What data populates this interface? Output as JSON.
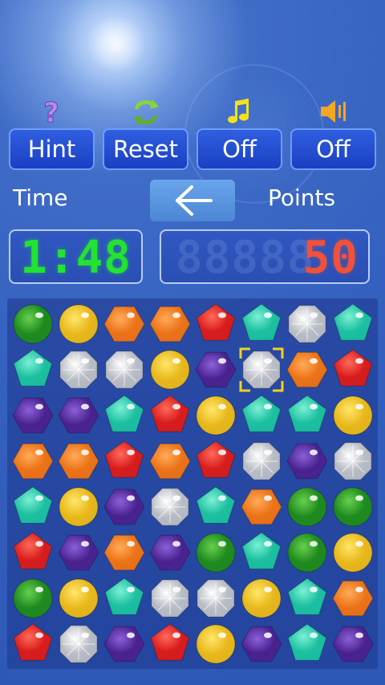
{
  "toolbar": {
    "hint_label": "Hint",
    "reset_label": "Reset",
    "music_label": "Off",
    "sound_label": "Off",
    "hint_icon": "question-mark-icon",
    "reset_icon": "refresh-arrows-icon",
    "music_icon": "music-note-icon",
    "sound_icon": "speaker-icon"
  },
  "status": {
    "time_label": "Time",
    "points_label": "Points",
    "time_value": "1:48",
    "points_value": "50",
    "points_placeholder": "88888",
    "back_icon": "arrow-left-icon"
  },
  "colors": {
    "time_digits": "#22e233",
    "points_digits": "#f0513a",
    "button_fill": "#2246d1",
    "button_border": "#6f9bff",
    "selector": "#f0d020"
  },
  "board": {
    "rows": 8,
    "cols": 8,
    "selected": {
      "row": 2,
      "col": 6
    },
    "grid": [
      [
        "G",
        "Y",
        "O",
        "O",
        "R",
        "T",
        "W",
        "T"
      ],
      [
        "T",
        "W",
        "W",
        "Y",
        "P",
        "W",
        "O",
        "R"
      ],
      [
        "P",
        "P",
        "T",
        "R",
        "Y",
        "T",
        "T",
        "Y"
      ],
      [
        "O",
        "O",
        "R",
        "O",
        "R",
        "W",
        "P",
        "W"
      ],
      [
        "T",
        "Y",
        "P",
        "W",
        "T",
        "O",
        "G",
        "G"
      ],
      [
        "R",
        "P",
        "O",
        "P",
        "G",
        "T",
        "G",
        "Y"
      ],
      [
        "G",
        "Y",
        "T",
        "W",
        "W",
        "Y",
        "T",
        "O"
      ],
      [
        "R",
        "W",
        "P",
        "R",
        "Y",
        "P",
        "T",
        "P"
      ]
    ]
  },
  "gems": {
    "G": {
      "name": "green-gem",
      "color": "#1e8a1e",
      "light": "#67d04f",
      "shape": "sphere"
    },
    "Y": {
      "name": "yellow-gem",
      "color": "#e8b81a",
      "light": "#ffe66a",
      "shape": "sphere"
    },
    "O": {
      "name": "orange-gem",
      "color": "#ec7216",
      "light": "#ffab5a",
      "shape": "hexagon"
    },
    "R": {
      "name": "red-gem",
      "color": "#d81c1c",
      "light": "#ff6a5a",
      "shape": "pentagon"
    },
    "T": {
      "name": "teal-gem",
      "color": "#1cc0a0",
      "light": "#7cf0d6",
      "shape": "pentagon"
    },
    "W": {
      "name": "white-gem",
      "color": "#b8bcc4",
      "light": "#ffffff",
      "shape": "octagon"
    },
    "P": {
      "name": "purple-gem",
      "color": "#4a2290",
      "light": "#8c60d8",
      "shape": "hexagon"
    }
  }
}
